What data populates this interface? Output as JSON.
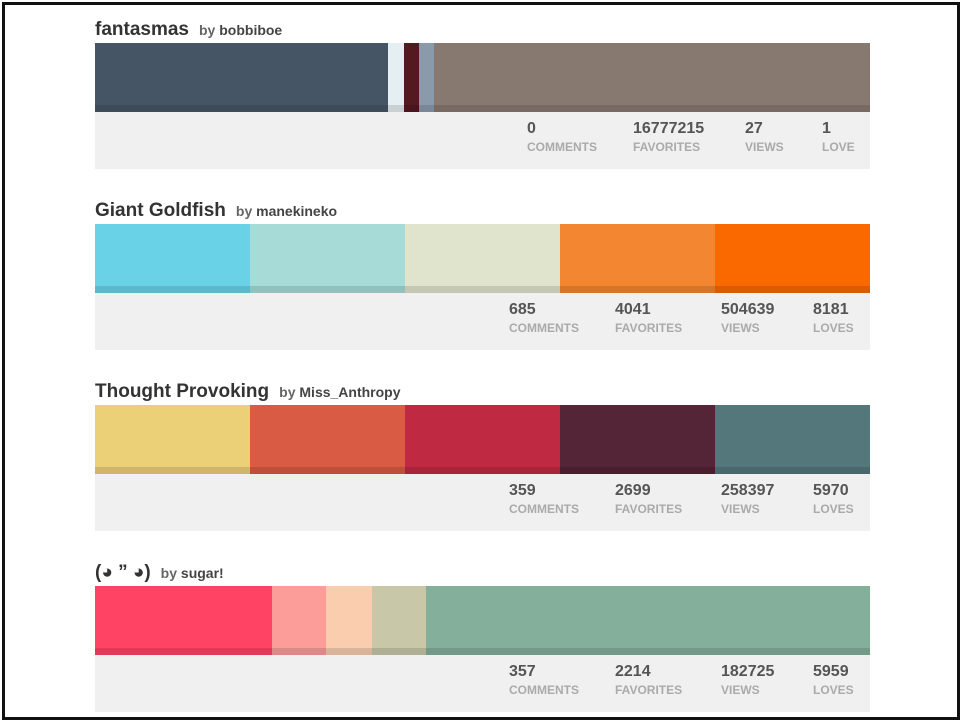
{
  "palettes": [
    {
      "title": "fantasmas",
      "by": "by",
      "user": "bobbiboe",
      "colors": [
        "#465565",
        "#e5eef2",
        "#531a20",
        "#8a9aab",
        "#877970"
      ],
      "weights": [
        293,
        16,
        15,
        15,
        436
      ],
      "stats": [
        {
          "value": "0",
          "label": "COMMENTS"
        },
        {
          "value": "16777215",
          "label": "FAVORITES"
        },
        {
          "value": "27",
          "label": "VIEWS"
        },
        {
          "value": "1",
          "label": "LOVE"
        }
      ]
    },
    {
      "title": "Giant Goldfish",
      "by": "by",
      "user": "manekineko",
      "colors": [
        "#69d2e7",
        "#a7dbd8",
        "#e0e4cc",
        "#f38630",
        "#fa6900"
      ],
      "weights": [
        155,
        155,
        155,
        155,
        155
      ],
      "stats": [
        {
          "value": "685",
          "label": "COMMENTS"
        },
        {
          "value": "4041",
          "label": "FAVORITES"
        },
        {
          "value": "504639",
          "label": "VIEWS"
        },
        {
          "value": "8181",
          "label": "LOVES"
        }
      ]
    },
    {
      "title": "Thought Provoking",
      "by": "by",
      "user": "Miss_Anthropy",
      "colors": [
        "#ecd078",
        "#d95b43",
        "#c02942",
        "#542437",
        "#53777a"
      ],
      "weights": [
        155,
        155,
        155,
        155,
        155
      ],
      "stats": [
        {
          "value": "359",
          "label": "COMMENTS"
        },
        {
          "value": "2699",
          "label": "FAVORITES"
        },
        {
          "value": "258397",
          "label": "VIEWS"
        },
        {
          "value": "5970",
          "label": "LOVES"
        }
      ]
    },
    {
      "title": "(◕ ” ◕)",
      "by": "by",
      "user": "sugar!",
      "colors": [
        "#fe4365",
        "#fc9d9a",
        "#f9cdad",
        "#c8c8a9",
        "#83af9b"
      ],
      "weights": [
        177,
        54,
        46,
        54,
        444
      ],
      "stats": [
        {
          "value": "357",
          "label": "COMMENTS"
        },
        {
          "value": "2214",
          "label": "FAVORITES"
        },
        {
          "value": "182725",
          "label": "VIEWS"
        },
        {
          "value": "5959",
          "label": "LOVES"
        }
      ]
    }
  ]
}
